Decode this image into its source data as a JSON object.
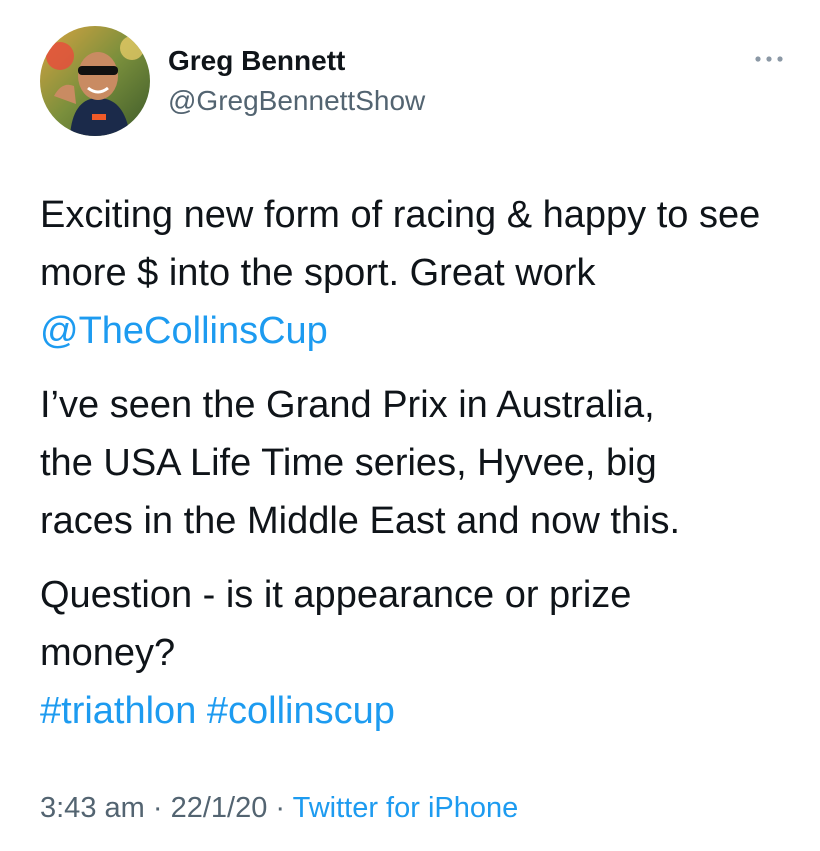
{
  "author": {
    "display_name": "Greg Bennett",
    "handle": "@GregBennettShow",
    "avatar_icon": "profile-photo"
  },
  "menu_icon": "more-horizontal-icon",
  "tweet": {
    "p1_text": "Exciting new form of racing & happy to see more $ into the sport. Great work ",
    "p1_mention": "@TheCollinsCup",
    "p2_line1": "I’ve seen the Grand Prix in Australia,",
    "p2_line2": "the USA Life Time series, Hyvee, big",
    "p2_line3": "races in the Middle East and now this.",
    "p3_line1": "Question - is it appearance or prize",
    "p3_line2": "money?",
    "hashtag1": "#triathlon",
    "hashtag2": "#collinscup"
  },
  "meta": {
    "time": "3:43 am",
    "separator1": " · ",
    "date": "22/1/20",
    "separator2": " · ",
    "source": "Twitter for iPhone"
  },
  "colors": {
    "link": "#1d9bf0",
    "secondary_text": "#536471",
    "primary_text": "#0f1419"
  }
}
